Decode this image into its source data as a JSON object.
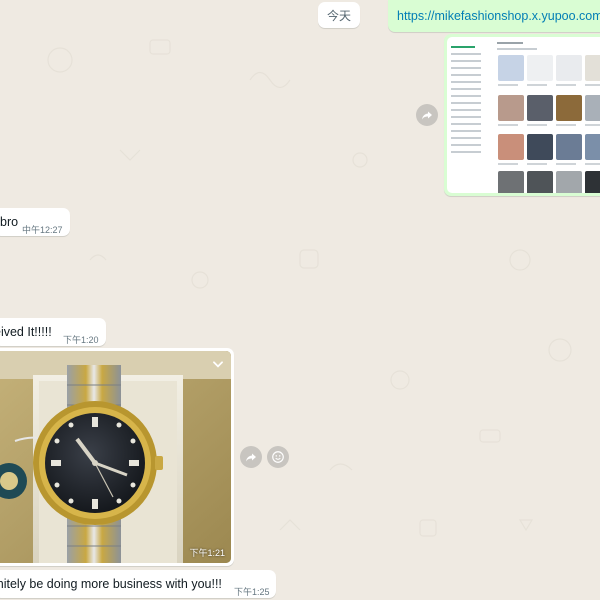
{
  "date_chip": "今天",
  "messages": {
    "link": {
      "url": "https://mikefashionshop.x.yupoo.com"
    },
    "bro": {
      "text": "bro",
      "time": "中午12:27"
    },
    "received": {
      "text": "eived It!!!!!",
      "time": "下午1:20"
    },
    "photo": {
      "time": "下午1:21"
    },
    "business": {
      "text": "initely be doing more business with you!!!",
      "time": "下午1:25"
    }
  },
  "icons": {
    "forward": "forward-arrow-icon",
    "emoji": "smiley-icon",
    "menu": "chevron-down-icon"
  },
  "colors": {
    "chat_background": "#efeae2",
    "incoming_bubble": "#ffffff",
    "outgoing_bubble": "#d9fdd3",
    "link": "#027eb5",
    "meta_text": "#667781"
  }
}
